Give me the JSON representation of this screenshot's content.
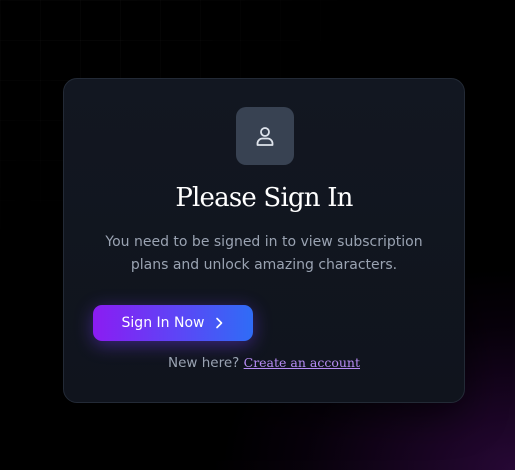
{
  "card": {
    "title": "Please Sign In",
    "description": "You need to be signed in to view subscription plans and unlock amazing characters.",
    "icon": "user-icon"
  },
  "actions": {
    "sign_in_label": "Sign In Now",
    "sign_in_icon": "chevron-right-icon"
  },
  "footer": {
    "prompt": "New here?",
    "link_label": "Create an account"
  },
  "colors": {
    "background": "#000000",
    "card_background": "#121721",
    "card_border": "#232a36",
    "avatar_box": "#384252",
    "button_gradient_start": "#8b1cf2",
    "button_gradient_end": "#2f6cf6",
    "link": "#b78cf5",
    "muted_text": "#9aa3b2"
  }
}
